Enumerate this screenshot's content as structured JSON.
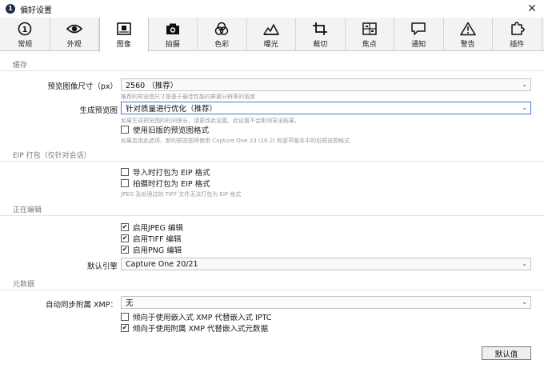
{
  "window": {
    "title": "偏好设置"
  },
  "tabs": [
    {
      "label": "常规",
      "icon": "info-circle-icon"
    },
    {
      "label": "外观",
      "icon": "eye-icon"
    },
    {
      "label": "图像",
      "icon": "image-frame-icon",
      "active": true
    },
    {
      "label": "拍摄",
      "icon": "camera-icon"
    },
    {
      "label": "色彩",
      "icon": "color-circles-icon"
    },
    {
      "label": "曝光",
      "icon": "exposure-mountain-icon"
    },
    {
      "label": "裁切",
      "icon": "crop-icon"
    },
    {
      "label": "焦点",
      "icon": "focus-icon"
    },
    {
      "label": "通知",
      "icon": "speech-bubble-icon"
    },
    {
      "label": "警告",
      "icon": "warning-triangle-icon"
    },
    {
      "label": "插件",
      "icon": "puzzle-piece-icon"
    }
  ],
  "cache": {
    "header": "缓存",
    "preview_size_label": "预览图像尺寸（px）",
    "preview_size_value": "2560 （推荐）",
    "preview_size_hint": "推荐的预览图尺寸是基于最佳性能的屏幕分辨率的宽度",
    "generate_label": "生成预览图",
    "generate_value": "针对质量进行优化（推荐）",
    "generate_hint": "如果生成预览图的时间很长，请更改此设置。此设置不会影响导出结果。",
    "legacy_label": "使用旧版的预览图格式",
    "legacy_checked": false,
    "legacy_hint": "如果启用此选项，新的预览图将使用 Capture One 23 (16.2) 和更早版本中的旧预览图格式"
  },
  "eip": {
    "header": "EIP 打包（仅针对会话）",
    "import_label": "导入时打包为 EIP 格式",
    "import_checked": false,
    "capture_label": "拍摄时打包为 EIP 格式",
    "capture_checked": false,
    "hint": "JPEG 及处理过的 TIFF 文件无法打包为 EIP 格式"
  },
  "editing": {
    "header": "正在编辑",
    "jpeg_label": "启用JPEG 编辑",
    "jpeg_checked": true,
    "tiff_label": "启用TIFF 编辑",
    "tiff_checked": true,
    "png_label": "启用PNG 编辑",
    "png_checked": true,
    "engine_label": "默认引擎",
    "engine_value": "Capture One 20/21"
  },
  "metadata": {
    "header": "元数据",
    "sync_label": "自动同步附属 XMP：",
    "sync_value": "无",
    "prefer_embedded_label": "倾向于使用嵌入式 XMP 代替嵌入式 IPTC",
    "prefer_embedded_checked": false,
    "prefer_sidecar_label": "倾向于使用附属 XMP 代替嵌入式元数据",
    "prefer_sidecar_checked": true
  },
  "buttons": {
    "default_label": "默认值"
  },
  "glyphs": {
    "check": "✔",
    "chevron": "⌄",
    "close": "✕",
    "app_icon": "1"
  }
}
